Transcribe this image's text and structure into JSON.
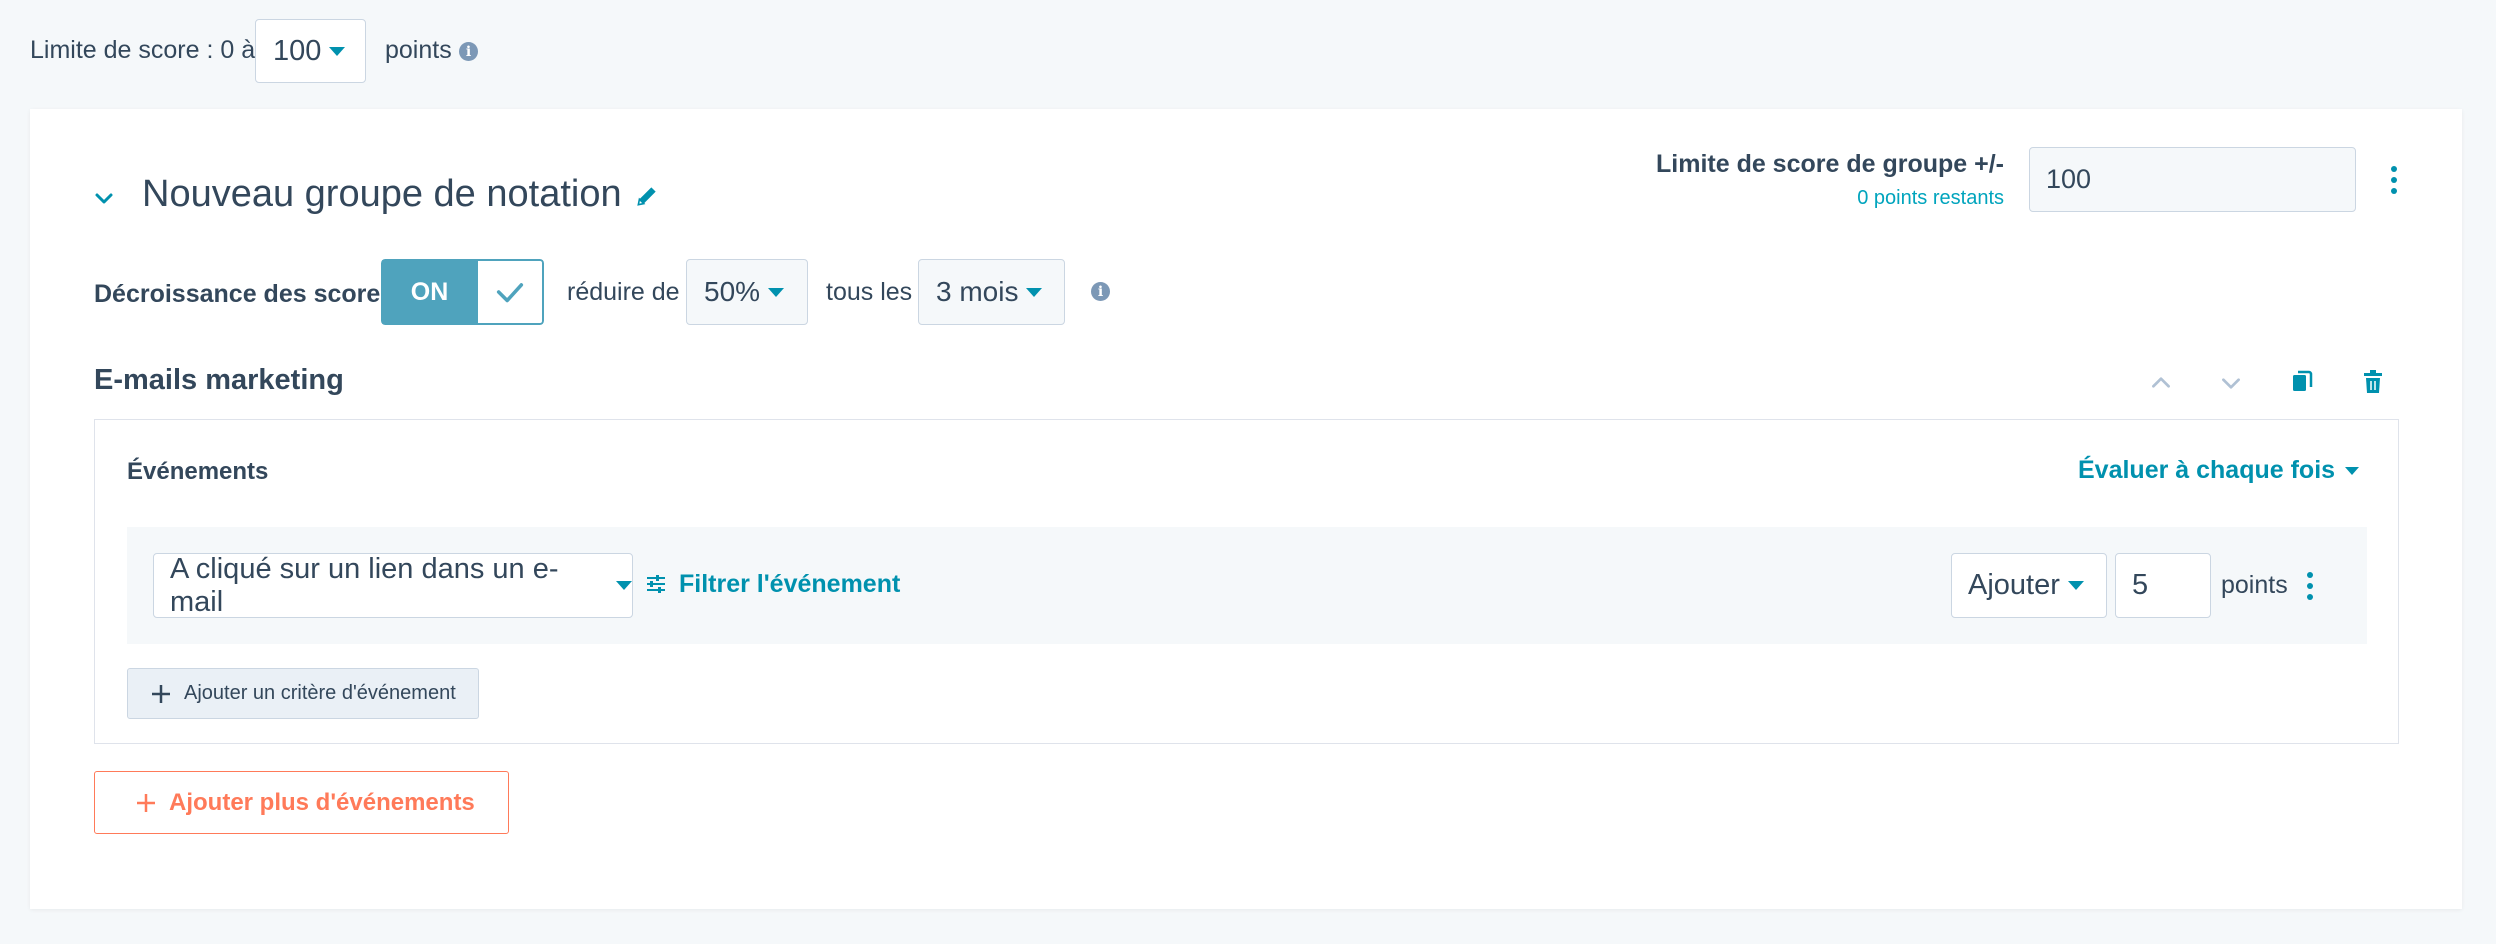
{
  "top": {
    "score_limit_label": "Limite de score : 0 à",
    "score_limit_value": "100",
    "points_label": "points"
  },
  "group": {
    "title": "Nouveau groupe de notation",
    "limit_label": "Limite de score de groupe +/-",
    "remaining_label": "0 points restants",
    "limit_value": "100"
  },
  "decay": {
    "label": "Décroissance des scores",
    "toggle_label": "ON",
    "reduce_label": "réduire de",
    "reduce_value": "50%",
    "every_label": "tous les",
    "period_value": "3 mois"
  },
  "section": {
    "title": "E-mails marketing"
  },
  "events": {
    "title": "Événements",
    "evaluate_label": "Évaluer à chaque fois",
    "event_type": "A cliqué sur un lien dans un e-mail",
    "filter_label": "Filtrer l'événement",
    "action_value": "Ajouter",
    "points_value": "5",
    "points_label": "points",
    "add_criteria_label": "Ajouter un critère d'événement",
    "add_more_label": "Ajouter plus d'événements"
  },
  "colors": {
    "accent": "#0091ae",
    "toggle": "#4fa3bd",
    "orange": "#ff7a59",
    "text": "#33475b"
  }
}
